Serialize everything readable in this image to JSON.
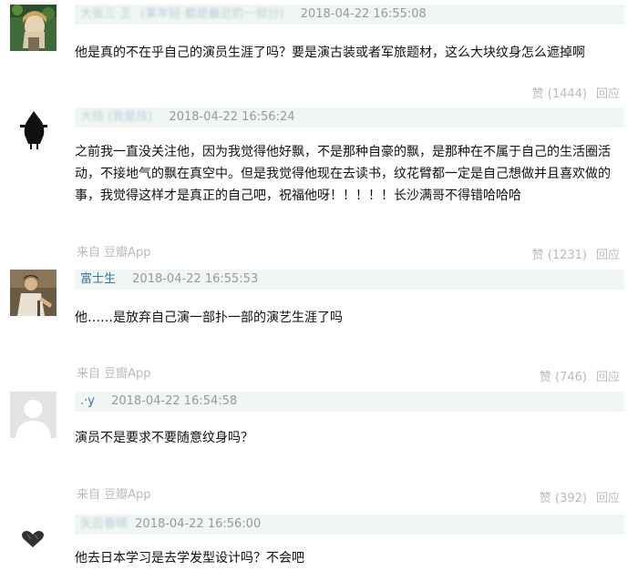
{
  "comments": [
    {
      "username": "大张三·王",
      "username_note": "(某年轻·都是最近的一部分)",
      "time": "2018-04-22 16:55:08",
      "content": "他是真的不在乎自己的演员生涯了吗？要是演古装或者军旅题材，这么大块纹身怎么遮掉啊",
      "source": "",
      "likes": "赞 (1444)",
      "reply": "回应"
    },
    {
      "username": "大技 (我是技)",
      "time": "2018-04-22 16:56:24",
      "content": "之前我一直没关注他，因为我觉得他好飘，不是那种自豪的飘，是那种在不属于自己的生活圈活动，不接地气的飘在真空中。但是我觉得他现在去读书，纹花臂都一定是自己想做并且喜欢做的事，我觉得这样才是真正的自己吧，祝福他呀！！！！！长沙满哥不得错哈哈哈",
      "source": "来自 豆瓣App",
      "likes": "赞 (1231)",
      "reply": "回应"
    },
    {
      "username": "富士生",
      "time": "2018-04-22 16:55:53",
      "content": "他……是放弃自己演一部扑一部的演艺生涯了吗",
      "source": "来自 豆瓣App",
      "likes": "赞 (746)",
      "reply": "回应"
    },
    {
      "username": ".·y",
      "time": "2018-04-22 16:54:58",
      "content": "演员不是要求不要随意纹身吗？",
      "source": "来自 豆瓣App",
      "likes": "赞 (392)",
      "reply": "回应"
    },
    {
      "username": "矢后春晴",
      "time": "2018-04-22 16:56:00",
      "content": "他去日本学习是去学发型设计吗？不会吧",
      "source": "",
      "likes": "",
      "reply": ""
    }
  ],
  "avatars": [
    {
      "icon": "anime-portrait-avatar",
      "bg": "#3f6b3a"
    },
    {
      "icon": "black-hooded-figure-avatar",
      "bg": "#ffffff"
    },
    {
      "icon": "performer-photo-avatar",
      "bg": "#6b5a44"
    },
    {
      "icon": "default-user-avatar",
      "bg": "#e3e3e3"
    },
    {
      "icon": "dark-heart-avatar",
      "bg": "#ffffff"
    }
  ],
  "colors": {
    "meta_bar_bg": "#f0f6f3",
    "username": "#3377aa",
    "timestamp": "#999999",
    "muted": "#bbbbbb"
  }
}
